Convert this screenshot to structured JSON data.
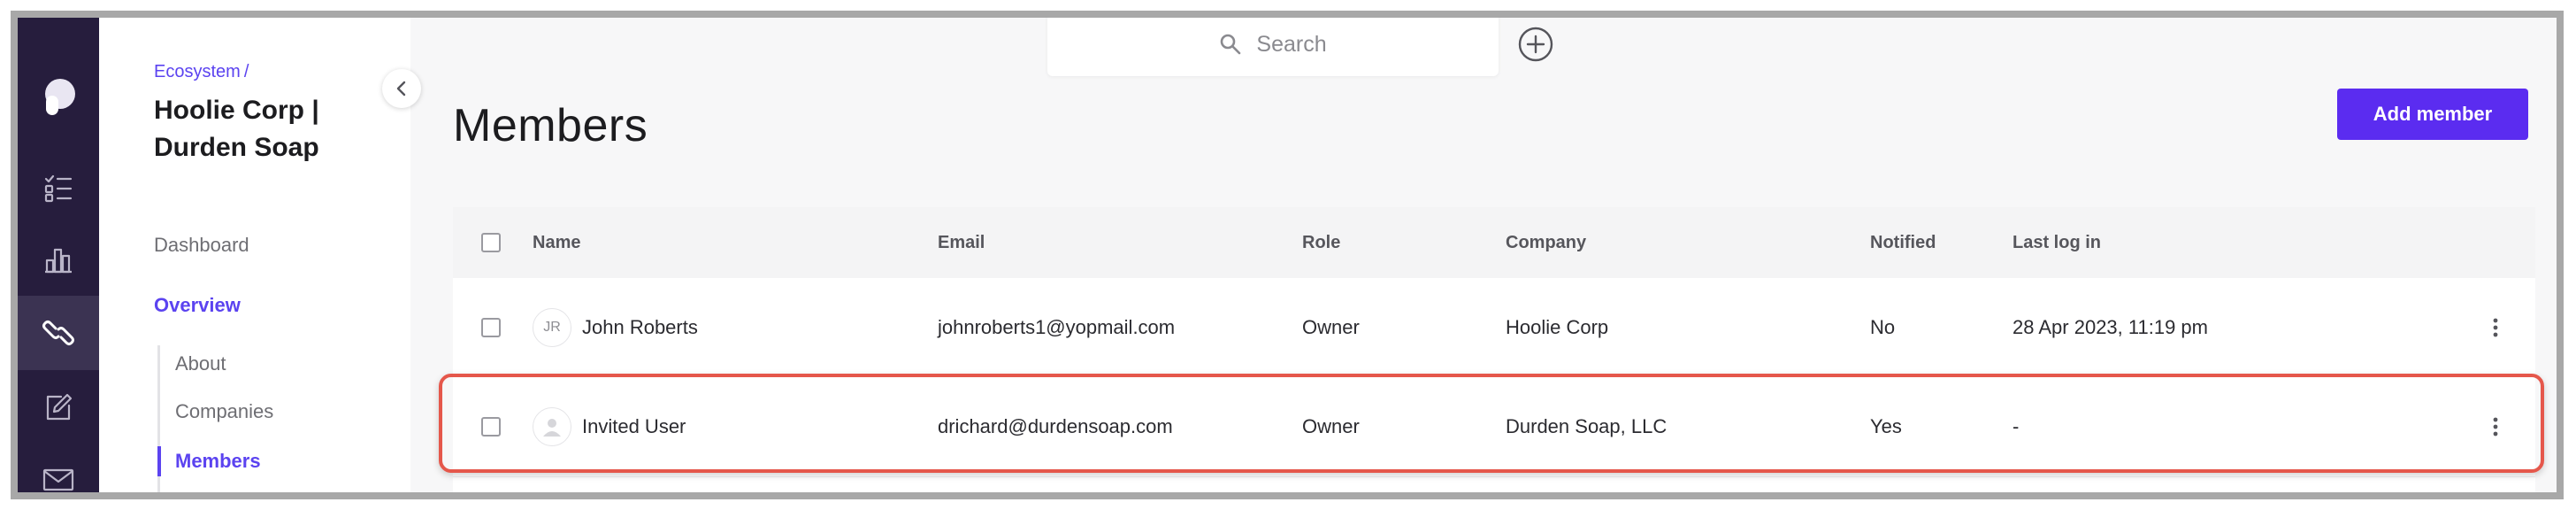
{
  "rail": {
    "items": [
      {
        "icon": "tasks-icon"
      },
      {
        "icon": "bar-chart-icon"
      },
      {
        "icon": "link-icon",
        "active": true
      },
      {
        "icon": "edit-icon"
      },
      {
        "icon": "mail-icon"
      }
    ]
  },
  "sidebar": {
    "breadcrumb": "Ecosystem",
    "breadcrumb_separator": "/",
    "org_line1": "Hoolie Corp |",
    "org_line2": "Durden Soap",
    "dashboard": "Dashboard",
    "overview": "Overview",
    "sub_items": {
      "about": "About",
      "companies": "Companies",
      "members": "Members"
    }
  },
  "header": {
    "search_placeholder": "Search"
  },
  "main": {
    "title": "Members",
    "add_member_label": "Add member"
  },
  "table": {
    "columns": {
      "name": "Name",
      "email": "Email",
      "role": "Role",
      "company": "Company",
      "notified": "Notified",
      "last_login": "Last log in"
    },
    "rows": [
      {
        "initials": "JR",
        "name": "John Roberts",
        "email": "johnroberts1@yopmail.com",
        "role": "Owner",
        "company": "Hoolie Corp",
        "notified": "No",
        "last_login": "28 Apr 2023, 11:19 pm"
      },
      {
        "initials": "",
        "name": "Invited User",
        "email": "drichard@durdensoap.com",
        "role": "Owner",
        "company": "Durden Soap, LLC",
        "notified": "Yes",
        "last_login": "-"
      }
    ]
  },
  "colors": {
    "accent": "#5b43f0",
    "button": "#5b2cf0",
    "rail_bg": "#261d3d",
    "highlight": "#e5574b"
  }
}
